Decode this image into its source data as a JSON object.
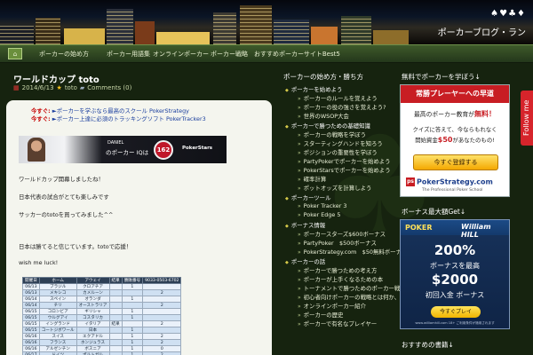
{
  "header": {
    "suits": "♠♥♣♦",
    "site_title": "ポーカーブログ・ラン"
  },
  "nav": {
    "home_label": "⌂",
    "items": [
      "ポーカーの始め方",
      "ポーカー用語集",
      "オンラインポーカー",
      "ポーカー戦略",
      "おすすめポーカーサイトBest5"
    ]
  },
  "post": {
    "title": "ワールドカップ toto",
    "date": "2014/6/13",
    "author": "toto",
    "comments": "Comments (0)",
    "promos": [
      {
        "label": "今すぐ:",
        "link": "►ポーカーを学ぶなら最高のスクール PokerStrategy"
      },
      {
        "label": "今すぐ:",
        "link": "►ポーカー上達に必須のトラッキングソフト PokerTracker3"
      }
    ],
    "banner": {
      "name": "DANIEL",
      "tagline": "のポーカー IQは",
      "badge": "162",
      "logo": "PokerStars"
    },
    "paragraphs": [
      "ワールドカップ開幕しましたね！",
      "日本代表の試合がとても楽しみです",
      "サッカーのtotoを買ってみました^^",
      "日本は勝てると信じています。totoで応援！",
      "wish me luck!"
    ],
    "table": {
      "headers": [
        "開催日",
        "ホーム",
        "アウェイ",
        "結果",
        "勝敗番号",
        "9033-0503-6702"
      ],
      "rows": [
        [
          "06/13",
          "ブラジル",
          "クロアチア",
          "",
          "1",
          ""
        ],
        [
          "06/13",
          "メキシコ",
          "カメルーン",
          "",
          "",
          "2"
        ],
        [
          "06/14",
          "スペイン",
          "オランダ",
          "",
          "1",
          ""
        ],
        [
          "06/14",
          "チリ",
          "オーストラリア",
          "",
          "",
          "2"
        ],
        [
          "06/15",
          "コロンビア",
          "ギリシャ",
          "",
          "1",
          ""
        ],
        [
          "06/15",
          "ウルグアイ",
          "コスタリカ",
          "",
          "1",
          ""
        ],
        [
          "06/15",
          "イングランド",
          "イタリア",
          "結果",
          "",
          "2"
        ],
        [
          "06/15",
          "コートジボワール",
          "日本",
          "",
          "1",
          ""
        ],
        [
          "06/16",
          "スイス",
          "エクアドル",
          "",
          "1",
          "2"
        ],
        [
          "06/16",
          "フランス",
          "ホンジュラス",
          "",
          "1",
          "2"
        ],
        [
          "06/16",
          "アルゼンチン",
          "ボスニア",
          "",
          "1",
          "0"
        ],
        [
          "06/17",
          "ドイツ",
          "ポルトガル",
          "",
          "1",
          "2"
        ],
        [
          "06/17",
          "イラン",
          "ナイジェリア",
          "",
          "1",
          "0"
        ],
        [
          "06/17",
          "ガーナ",
          "アメリカ",
          "",
          "",
          "2"
        ]
      ]
    }
  },
  "mid_sidebar": {
    "heading": "ポーカーの始め方・勝ち方",
    "sections": [
      {
        "title": "ポーカーを始めよう",
        "items": [
          "ポーカーのルールを覚えよう",
          "ポーカーの役の強さを覚えよう?",
          "世界のWSOP大会"
        ]
      },
      {
        "title": "ポーカーで勝つための基礎知識",
        "items": [
          "ポーカーの戦略を学ぼう",
          "スターティングハンドを知ろう",
          "ポジションの重要性を学ぼう",
          "PartyPokerでポーカーを始めよう",
          "PokerStarsでポーカーを始めよう",
          "確率計算",
          "ポットオッズを計算しよう"
        ]
      },
      {
        "title": "ポーカーツール",
        "items": [
          "Poker Tracker 3",
          "Poker Edge 5"
        ]
      },
      {
        "title": "ボーナス情報",
        "items": [
          "ポーカースターズ$600ボーナス",
          "PartyPoker　$500ボーナス",
          "PokerStrategy.com　$50無料ボーナス"
        ]
      },
      {
        "title": "ポーカーの話",
        "items": [
          "ポーカーで勝つための考え方",
          "ポーカーが上手くなるための本",
          "トーナメントで勝つためのポーカー戦略",
          "初心者向けポーカーの戦略とは何か、どうすれば勝てるか",
          "オンラインポーカー紹介",
          "ポーカーの歴史",
          "ポーカーで有名なプレイヤー"
        ]
      }
    ]
  },
  "right_sidebar": {
    "heading1": "無料でポーカーを学ぼう↓",
    "ps_ad": {
      "head": "常勝プレーヤーへの早道",
      "line1_pre": "最高のポーカー教育が",
      "line1_em": "無料！",
      "line2": "クイズに答えて、今ならもれなく",
      "line3_pre": "開始資金",
      "line3_em": "$50",
      "line3_post": "があなたのもの!",
      "button": "今すぐ登録する",
      "logo_mark": "ps",
      "logo": "PokerStrategy.com",
      "tag": "The Professional Poker School"
    },
    "follow": "Follow me",
    "heading2": "ボーナス最大額Get↓",
    "wh_ad": {
      "poker": "POKER",
      "logo": "William HILL",
      "pct": "200%",
      "line2": "ボーナスを最高",
      "amount": "$2000",
      "line4": "初回入金 ボーナス",
      "button": "今すぐプレイ",
      "fine": "www.williamhill.com 18+ ご利用条件が適用されます"
    },
    "heading3": "おすすめの書籍↓"
  },
  "colors": {
    "background": "#16230f",
    "nav": "#2f4520",
    "accent_red": "#c81d23",
    "link": "#1a3e9e"
  }
}
